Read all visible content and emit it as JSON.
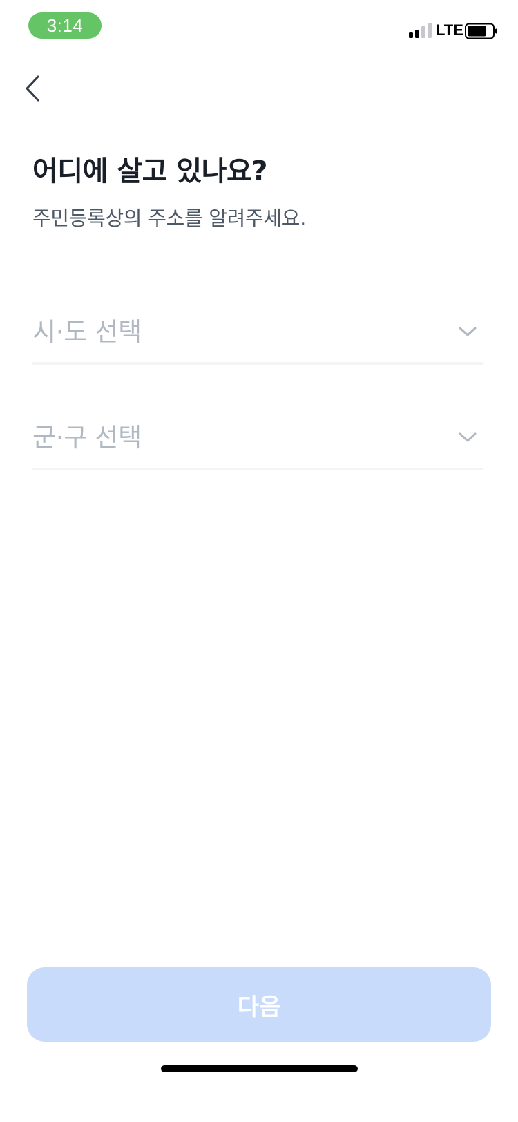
{
  "status_bar": {
    "time": "3:14",
    "network": "LTE",
    "time_pill_color": "#65c466",
    "signal_icon": "signal-bars-icon",
    "battery_icon": "battery-icon"
  },
  "nav": {
    "back_icon": "chevron-left-icon"
  },
  "header": {
    "title": "어디에 살고 있나요?",
    "subtitle": "주민등록상의 주소를 알려주세요."
  },
  "form": {
    "sido_select": {
      "placeholder": "시·도 선택",
      "icon": "chevron-down-icon"
    },
    "gungu_select": {
      "placeholder": "군·구 선택",
      "icon": "chevron-down-icon"
    }
  },
  "footer": {
    "next_label": "다음",
    "next_button_color": "#c9dbfa",
    "next_disabled": true
  },
  "colors": {
    "title": "#191f28",
    "subtitle": "#4e5968",
    "placeholder": "#b0b8c1",
    "divider": "#f2f4f6"
  }
}
